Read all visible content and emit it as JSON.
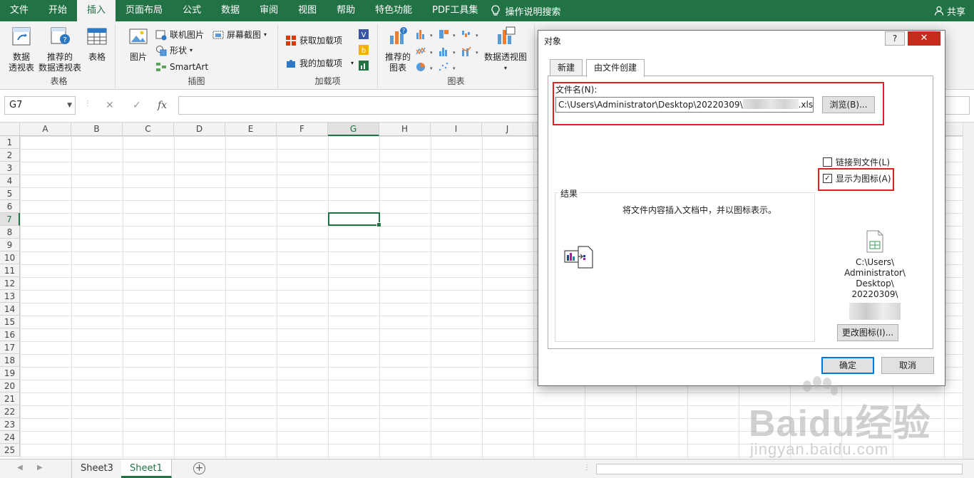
{
  "menu": {
    "items": [
      "文件",
      "开始",
      "插入",
      "页面布局",
      "公式",
      "数据",
      "审阅",
      "视图",
      "帮助",
      "特色功能",
      "PDF工具集"
    ],
    "active_index": 2,
    "help_search": "操作说明搜索",
    "share": "共享"
  },
  "ribbon": {
    "groups": {
      "tables": "表格",
      "illustrations": "插图",
      "addins": "加载项",
      "charts": "图表"
    },
    "buttons": {
      "pivot_line1": "数据",
      "pivot_line2": "透视表",
      "rec_pivot_line1": "推荐的",
      "rec_pivot_line2": "数据透视表",
      "table": "表格",
      "picture": "图片",
      "online_picture": "联机图片",
      "shapes": "形状",
      "smartart": "SmartArt",
      "screenshot": "屏幕截图",
      "get_addins": "获取加载项",
      "my_addins": "我的加载项",
      "rec_chart_line1": "推荐的",
      "rec_chart_line2": "图表",
      "pivot_chart": "数据透视图"
    }
  },
  "formula_bar": {
    "name_box": "G7",
    "fx": "fx",
    "cancel": "✕",
    "enter": "✓",
    "value": ""
  },
  "grid": {
    "columns": [
      "A",
      "B",
      "C",
      "D",
      "E",
      "F",
      "G",
      "H",
      "I",
      "J"
    ],
    "rows": [
      "1",
      "2",
      "3",
      "4",
      "5",
      "6",
      "7",
      "8",
      "9",
      "10",
      "11",
      "12",
      "13",
      "14",
      "15",
      "16",
      "17",
      "18",
      "19",
      "20",
      "21",
      "22",
      "23",
      "24",
      "25"
    ],
    "selected_column": "G",
    "selected_row": "7"
  },
  "sheets": {
    "tabs": [
      "Sheet3",
      "Sheet1"
    ],
    "active": "Sheet1",
    "add": "+"
  },
  "dialog": {
    "title": "对象",
    "help": "?",
    "close": "✕",
    "tabs": [
      "新建",
      "由文件创建"
    ],
    "active_tab": "由文件创建",
    "filename_label": "文件名(N):",
    "filename_prefix": "C:\\Users\\Administrator\\Desktop\\20220309\\",
    "filename_suffix": ".xlsx",
    "browse": "浏览(B)...",
    "link_to_file": "链接到文件(L)",
    "link_checked": false,
    "display_as_icon": "显示为图标(A)",
    "icon_checked": true,
    "result_label": "结果",
    "result_text": "将文件内容插入文档中，并以图标表示。",
    "icon_caption": [
      "C:\\Users\\",
      "Administrator\\",
      "Desktop\\",
      "20220309\\"
    ],
    "change_icon": "更改图标(I)...",
    "ok": "确定",
    "cancel": "取消"
  },
  "watermark": {
    "main": "Baidu经验",
    "sub": "jingyan.baidu.com"
  },
  "colors": {
    "accent": "#217346",
    "highlight": "#e0201e",
    "close": "#c42b1c"
  }
}
